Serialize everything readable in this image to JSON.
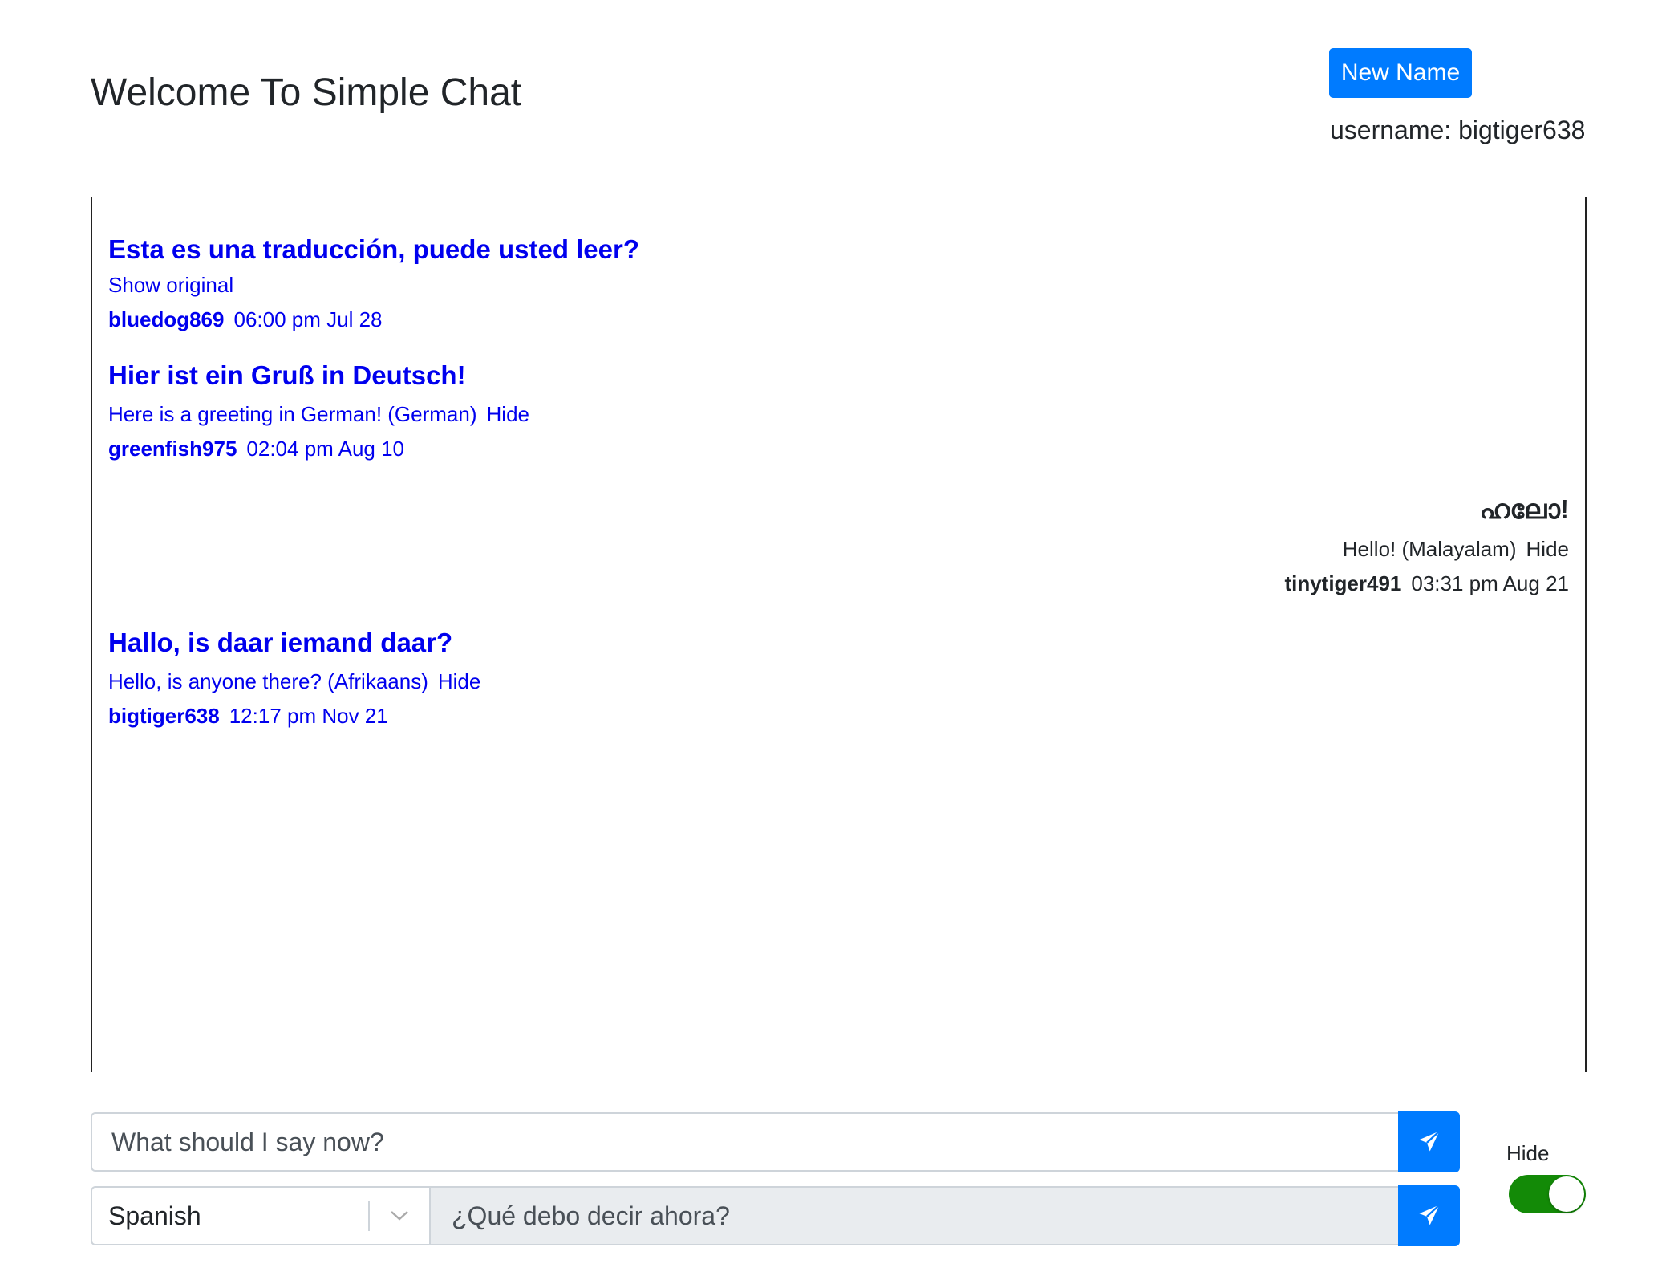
{
  "header": {
    "title": "Welcome To Simple Chat",
    "new_name_label": "New Name",
    "username_label": "username: bigtiger638"
  },
  "messages": [
    {
      "text": "Esta es una traducción, puede usted leer?",
      "original_link": "Show original",
      "user": "bluedog869",
      "time": "06:00 pm Jul 28"
    },
    {
      "text": "Hier ist ein Gruß in Deutsch!",
      "translation": "Here is a greeting in German! (German)",
      "hide": "Hide",
      "user": "greenfish975",
      "time": "02:04 pm Aug 10"
    },
    {
      "text": "ഹലോ!",
      "translation": "Hello! (Malayalam)",
      "hide": "Hide",
      "user": "tinytiger491",
      "time": "03:31 pm Aug 21"
    },
    {
      "text": "Hallo, is daar iemand daar?",
      "translation": "Hello, is anyone there? (Afrikaans)",
      "hide": "Hide",
      "user": "bigtiger638",
      "time": "12:17 pm Nov 21"
    }
  ],
  "composer": {
    "message_value": "",
    "message_placeholder": "What should I say now?",
    "language": "Spanish",
    "translated_text": "¿Qué debo decir ahora?"
  },
  "toggle": {
    "label": "Hide",
    "on": true
  },
  "colors": {
    "primary": "#007bff",
    "link_blue": "#0000ee",
    "toggle_on": "#138a07"
  }
}
